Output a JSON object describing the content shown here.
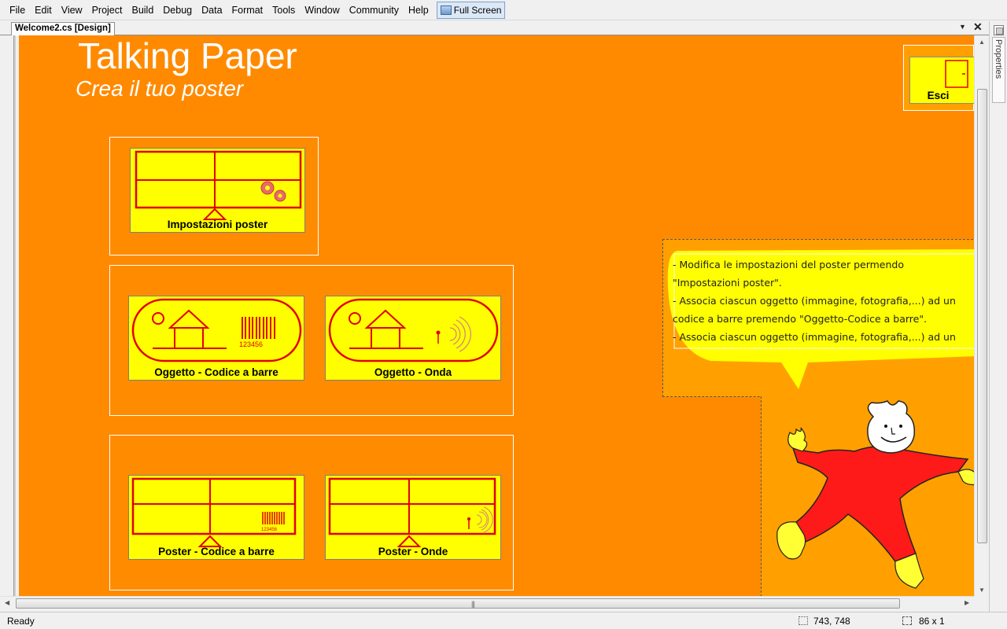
{
  "menu": {
    "items": [
      "File",
      "Edit",
      "View",
      "Project",
      "Build",
      "Debug",
      "Data",
      "Format",
      "Tools",
      "Window",
      "Community",
      "Help"
    ],
    "full_screen": "Full Screen"
  },
  "document_tab": {
    "label": "Welcome2.cs [Design]"
  },
  "side_panel": {
    "label": "Properties"
  },
  "canvas": {
    "title": "Talking Paper",
    "subtitle": "Crea il tuo poster",
    "background_color": "#ff8a00",
    "buttons": {
      "impostazioni": "Impostazioni poster",
      "oggetto_codice": "Oggetto - Codice a barre",
      "oggetto_onda": "Oggetto - Onda",
      "poster_codice": "Poster - Codice a barre",
      "poster_onde": "Poster - Onde",
      "esci": "Esci"
    },
    "barcode_digits": "123456",
    "bubble_lines": [
      "- Modifica le impostazioni del poster permendo",
      "\"Impostazioni poster\".",
      "- Associa ciascun oggetto (immagine, fotografia,...) ad un",
      "codice a barre premendo \"Oggetto-Codice a barre\".",
      "- Associa ciascun oggetto (immagine, fotografia,...) ad un"
    ]
  },
  "status_bar": {
    "ready": "Ready",
    "position": "743, 748",
    "size": "86 x 1"
  }
}
